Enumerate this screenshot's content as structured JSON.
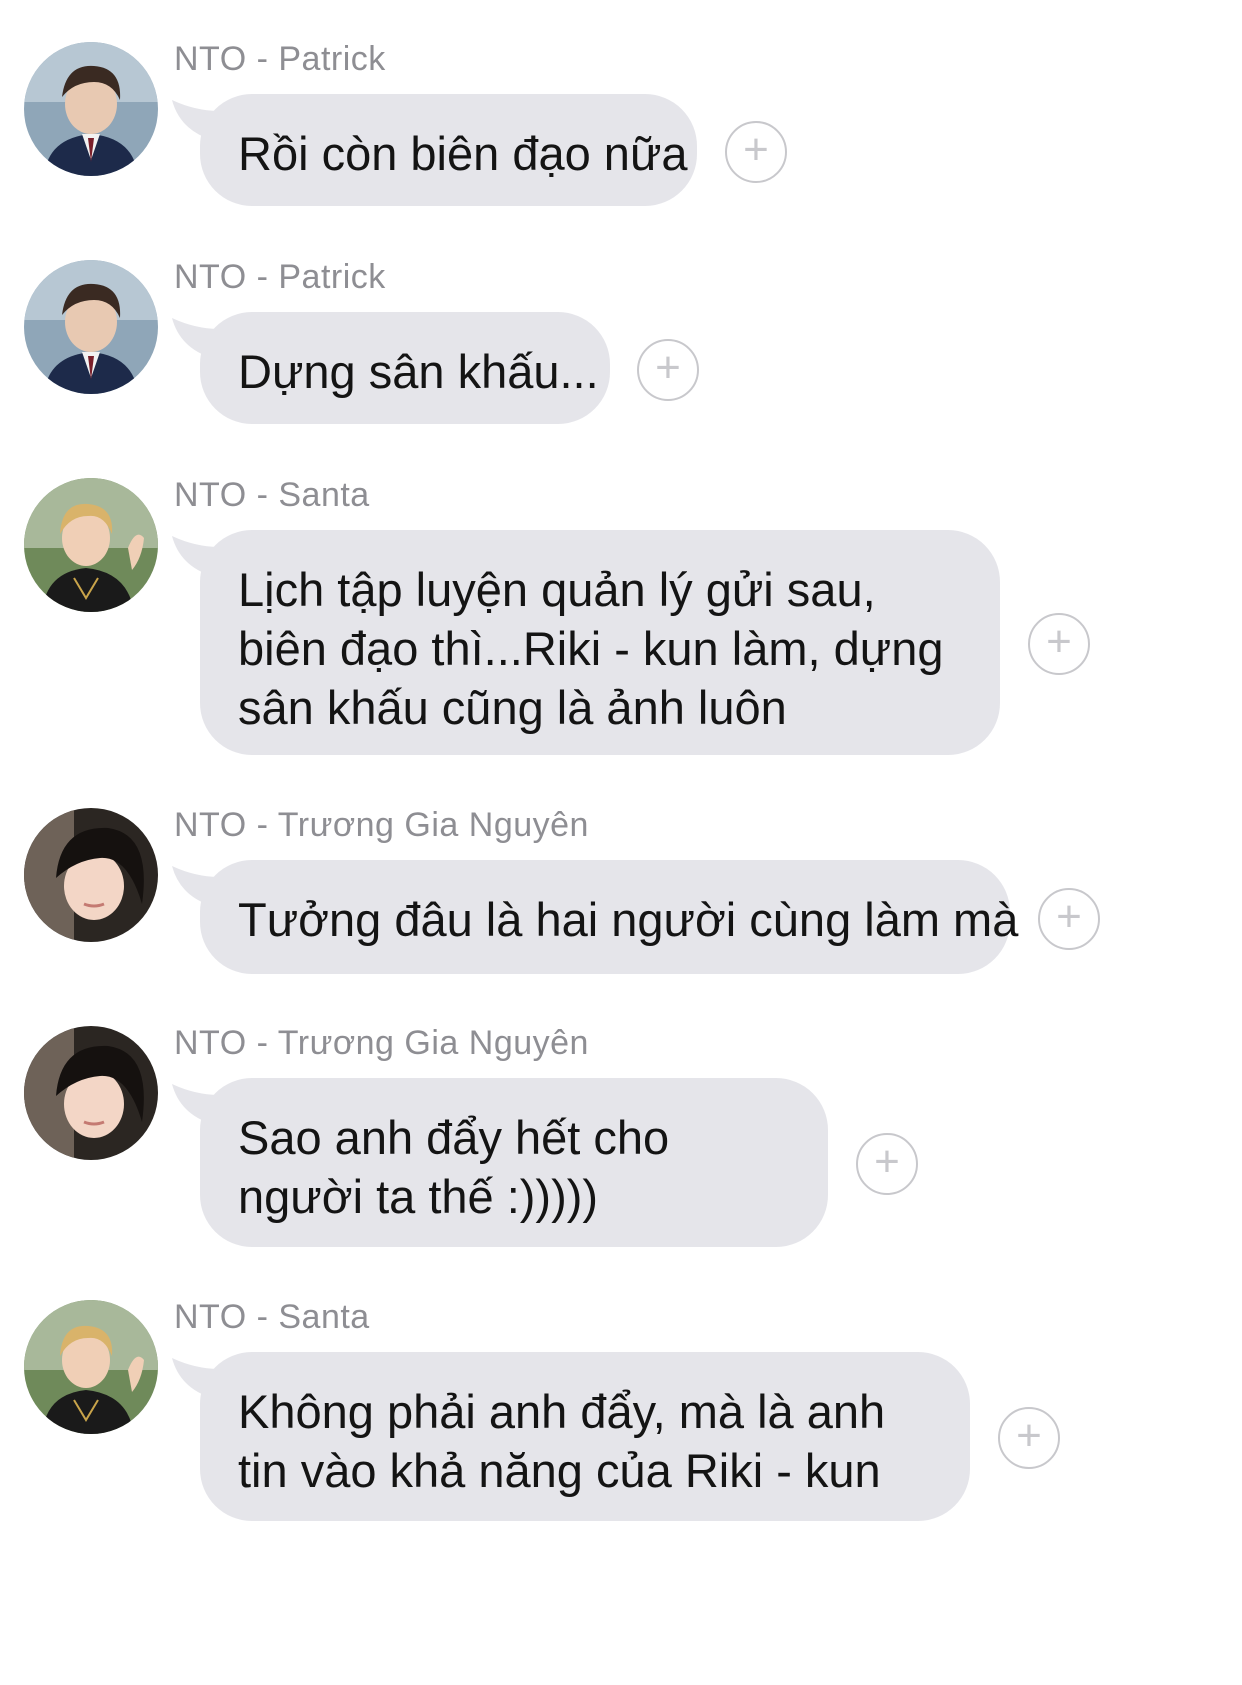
{
  "chat": {
    "messages": [
      {
        "sender": "NTO - Patrick",
        "avatar": "patrick-avatar",
        "text": "Rồi còn biên đạo nữa"
      },
      {
        "sender": "NTO - Patrick",
        "avatar": "patrick-avatar",
        "text": "Dựng sân khấu..."
      },
      {
        "sender": "NTO - Santa",
        "avatar": "santa-avatar",
        "text": "Lịch tập luyện quản lý gửi sau, biên đạo thì...Riki - kun làm, dựng sân khấu cũng là ảnh luôn"
      },
      {
        "sender": "NTO - Trương Gia Nguyên",
        "avatar": "nguyen-avatar",
        "text": "Tưởng đâu là hai người cùng làm mà"
      },
      {
        "sender": "NTO - Trương Gia Nguyên",
        "avatar": "nguyen-avatar",
        "text": "Sao anh đẩy hết cho người ta thế :)))))"
      },
      {
        "sender": "NTO - Santa",
        "avatar": "santa-avatar",
        "text": "Không phải anh đẩy, mà là anh tin vào khả năng của Riki - kun"
      }
    ],
    "react_icon": "plus-circle-icon",
    "colors": {
      "bubble": "#e5e5ea",
      "sender": "#8e8e93",
      "text": "#141414",
      "icon": "#c8c8cc"
    }
  }
}
